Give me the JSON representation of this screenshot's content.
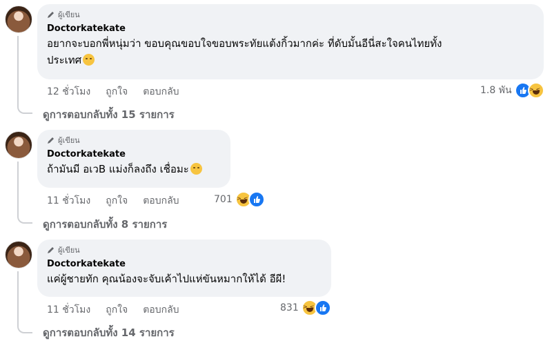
{
  "comments": [
    {
      "badge": "ผู้เขียน",
      "author": "Doctorkatekate",
      "line1": "อยากจะบอกพี่หนุ่มว่า ขอบคุณขอบใจขอบพระทัยแต้งกิ้วมากค่ะ ที่ดับมั้นอีนี่สะใจคนไทยทั้ง",
      "line2": "ประเทศ",
      "time": "12 ชั่วโมง",
      "like": "ถูกใจ",
      "reply": "ตอบกลับ",
      "reaction_count": "1.8 พัน",
      "replies": "ดูการตอบกลับทั้ง 15 รายการ"
    },
    {
      "badge": "ผู้เขียน",
      "author": "Doctorkatekate",
      "line1": "ถ้ามันมี อเวB แม่งก็ลงถึง เชื่อมะ",
      "time": "11 ชั่วโมง",
      "like": "ถูกใจ",
      "reply": "ตอบกลับ",
      "reaction_count": "701",
      "replies": "ดูการตอบกลับทั้ง 8 รายการ"
    },
    {
      "badge": "ผู้เขียน",
      "author": "Doctorkatekate",
      "line1": "แค่ผู้ชายทัก คุณน้องจะจับเค้าไปแห่ขันหมากให้ได้ อีผี!",
      "time": "11 ชั่วโมง",
      "like": "ถูกใจ",
      "reply": "ตอบกลับ",
      "reaction_count": "831",
      "replies": "ดูการตอบกลับทั้ง 14 รายการ"
    }
  ],
  "icons": {
    "badge": "pencil-icon",
    "reaction_like": "like-reaction-icon",
    "reaction_haha": "haha-reaction-icon"
  },
  "colors": {
    "bubble": "#f0f2f5",
    "muted": "#65676b",
    "like_blue": "#1877f2",
    "haha_yellow": "#f7c440"
  }
}
